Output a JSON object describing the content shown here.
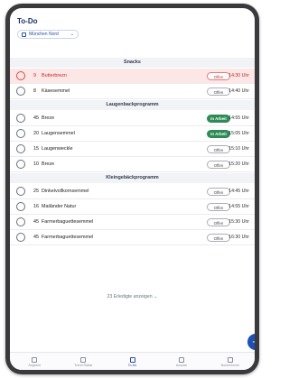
{
  "app": {
    "title": "To-Do"
  },
  "filter": {
    "label": "München Nord",
    "icon": "store-icon"
  },
  "sections": [
    {
      "title": "Snacks",
      "items": [
        {
          "qty": "9",
          "name": "Butterbrezn",
          "status": "Offen",
          "status_type": "offen",
          "time": "14:30 Uhr",
          "highlight": true
        },
        {
          "qty": "8",
          "name": "Käsesemmel",
          "status": "Offen",
          "status_type": "offen",
          "time": "14:40 Uhr",
          "highlight": false
        }
      ]
    },
    {
      "title": "Laugenbackprogramm",
      "items": [
        {
          "qty": "45",
          "name": "Breze",
          "status": "In Arbeit",
          "status_type": "inarbeit",
          "time": "14:55 Uhr",
          "highlight": false
        },
        {
          "qty": "20",
          "name": "Laugensemmel",
          "status": "In Arbeit",
          "status_type": "inarbeit",
          "time": "15:05 Uhr",
          "highlight": false
        },
        {
          "qty": "15",
          "name": "Laugenweckle",
          "status": "Offen",
          "status_type": "offen",
          "time": "15:10 Uhr",
          "highlight": false
        },
        {
          "qty": "10",
          "name": "Breze",
          "status": "Offen",
          "status_type": "offen",
          "time": "15:20 Uhr",
          "highlight": false
        }
      ]
    },
    {
      "title": "Kleingebäckprogramm",
      "items": [
        {
          "qty": "25",
          "name": "Dinkelvollkornsemmel",
          "status": "Offen",
          "status_type": "offen",
          "time": "14:45 Uhr",
          "highlight": false
        },
        {
          "qty": "16",
          "name": "Mailänder Natur",
          "status": "Offen",
          "status_type": "offen",
          "time": "14:55 Uhr",
          "highlight": false
        },
        {
          "qty": "45",
          "name": "Farmerbaguettesemmel",
          "status": "Offen",
          "status_type": "offen",
          "time": "15:30 Uhr",
          "highlight": false
        },
        {
          "qty": "45",
          "name": "Farmerbaguettesemmel",
          "status": "Offen",
          "status_type": "offen",
          "time": "16:30 Uhr",
          "highlight": false
        }
      ]
    }
  ],
  "show_done": {
    "label": "23 Erledigte anzeigen",
    "icon": "chevron-down-icon"
  },
  "fab": {
    "label": "+",
    "icon": "plus-icon"
  },
  "tabbar": {
    "items": [
      {
        "label": "Angebot",
        "icon": "tag-icon",
        "active": false
      },
      {
        "label": "Trend Radar",
        "icon": "radar-icon",
        "active": false
      },
      {
        "label": "To-Do",
        "icon": "checklist-icon",
        "active": true
      },
      {
        "label": "Auswat",
        "icon": "calendar-icon",
        "active": false
      },
      {
        "label": "Nutzer/Innen",
        "icon": "person-icon",
        "active": false
      }
    ]
  },
  "colors": {
    "accent": "#1e4fb3",
    "in_arbeit": "#2e8b57",
    "highlight_bg": "#fde6e6",
    "highlight_text": "#c62828"
  }
}
